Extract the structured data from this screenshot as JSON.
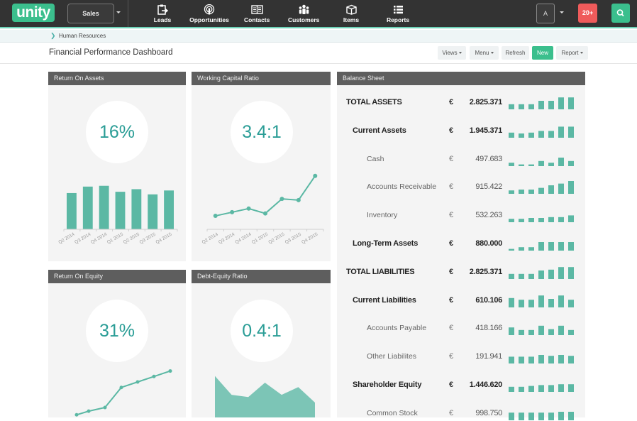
{
  "app": {
    "logo_text": "unity",
    "module": "Sales",
    "nav": [
      {
        "label": "Leads",
        "icon": "clipboard-arrow-icon"
      },
      {
        "label": "Opportunities",
        "icon": "broadcast-icon"
      },
      {
        "label": "Contacts",
        "icon": "open-book-icon"
      },
      {
        "label": "Customers",
        "icon": "people-group-icon"
      },
      {
        "label": "Items",
        "icon": "box-icon"
      },
      {
        "label": "Reports",
        "icon": "list-icon"
      }
    ],
    "user_initial": "A",
    "notifications": "20+",
    "search_icon": "search-icon"
  },
  "breadcrumb": {
    "items": [
      "Human Resources"
    ]
  },
  "page": {
    "title": "Financial Performance Dashboard",
    "toolbar": {
      "views": "Views",
      "menu": "Menu",
      "refresh": "Refresh",
      "new": "New",
      "report": "Report"
    }
  },
  "colors": {
    "accent": "#3bbf8d",
    "chart": "#5bb8a4",
    "danger": "#ef5b5b",
    "gauge_text": "#2a9d96"
  },
  "chart_data": [
    {
      "type": "bar",
      "title": "Return On Assets",
      "kpi": "16%",
      "categories": [
        "Q2 2014",
        "Q3 2014",
        "Q4 2014",
        "Q1 2015",
        "Q2 2015",
        "Q3 2015",
        "Q4 2015"
      ],
      "values": [
        14,
        16.5,
        16.8,
        14.5,
        15.5,
        13.5,
        15
      ]
    },
    {
      "type": "line",
      "title": "Working Capital Ratio",
      "kpi": "3.4:1",
      "categories": [
        "Q2 2014",
        "Q3 2014",
        "Q4 2014",
        "Q1 2015",
        "Q2 2015",
        "Q3 2015",
        "Q4 2015"
      ],
      "values": [
        1.2,
        1.5,
        1.8,
        1.4,
        2.6,
        2.5,
        4.5
      ]
    },
    {
      "type": "line",
      "title": "Return On Equity",
      "kpi": "31%",
      "values": [
        18,
        20,
        22,
        33,
        36,
        39,
        42
      ]
    },
    {
      "type": "area",
      "title": "Debt-Equity Ratio",
      "kpi": "0.4:1",
      "values": [
        0.62,
        0.45,
        0.43,
        0.56,
        0.45,
        0.52,
        0.38
      ]
    }
  ],
  "balance_sheet": {
    "title": "Balance Sheet",
    "currency": "€",
    "rows": [
      {
        "label": "TOTAL ASSETS",
        "level": 0,
        "value": "2.825.371",
        "spark": [
          3,
          3,
          3,
          5,
          5,
          7,
          7
        ]
      },
      {
        "label": "Current Assets",
        "level": 1,
        "value": "1.945.371",
        "spark": [
          3,
          2.5,
          3,
          4,
          4,
          6.5,
          6.5
        ]
      },
      {
        "label": "Cash",
        "level": 2,
        "value": "497.683",
        "spark": [
          2,
          1,
          1,
          3,
          2,
          5,
          3
        ]
      },
      {
        "label": "Accounts Receivable",
        "level": 2,
        "value": "915.422",
        "spark": [
          2,
          2.5,
          2.5,
          3.5,
          5,
          6,
          7.5
        ]
      },
      {
        "label": "Inventory",
        "level": 2,
        "value": "532.263",
        "spark": [
          2,
          2,
          2.5,
          2.5,
          3,
          3,
          4
        ]
      },
      {
        "label": "Long-Term Assets",
        "level": 1,
        "value": "880.000",
        "spark": [
          1,
          2,
          2,
          5,
          5,
          5,
          5
        ]
      },
      {
        "label": "TOTAL LIABILITIES",
        "level": 0,
        "value": "2.825.371",
        "spark": [
          3,
          3,
          3,
          5,
          5.5,
          7,
          7
        ]
      },
      {
        "label": "Current Liabilities",
        "level": 1,
        "value": "610.106",
        "spark": [
          5.5,
          4.5,
          4.5,
          7,
          5,
          7,
          4.5
        ]
      },
      {
        "label": "Accounts Payable",
        "level": 2,
        "value": "418.166",
        "spark": [
          4.5,
          3,
          3,
          5.5,
          3.5,
          5.5,
          3
        ]
      },
      {
        "label": "Other Liabilites",
        "level": 2,
        "value": "191.941",
        "spark": [
          4,
          4,
          4,
          5,
          4.5,
          5,
          4.5
        ]
      },
      {
        "label": "Shareholder Equity",
        "level": 1,
        "value": "1.446.620",
        "spark": [
          3,
          3,
          3.5,
          4,
          4,
          4.5,
          4.5
        ]
      },
      {
        "label": "Common Stock",
        "level": 2,
        "value": "998.750",
        "spark": [
          4.5,
          4.5,
          4.5,
          4.5,
          4.5,
          5,
          5
        ]
      }
    ]
  }
}
